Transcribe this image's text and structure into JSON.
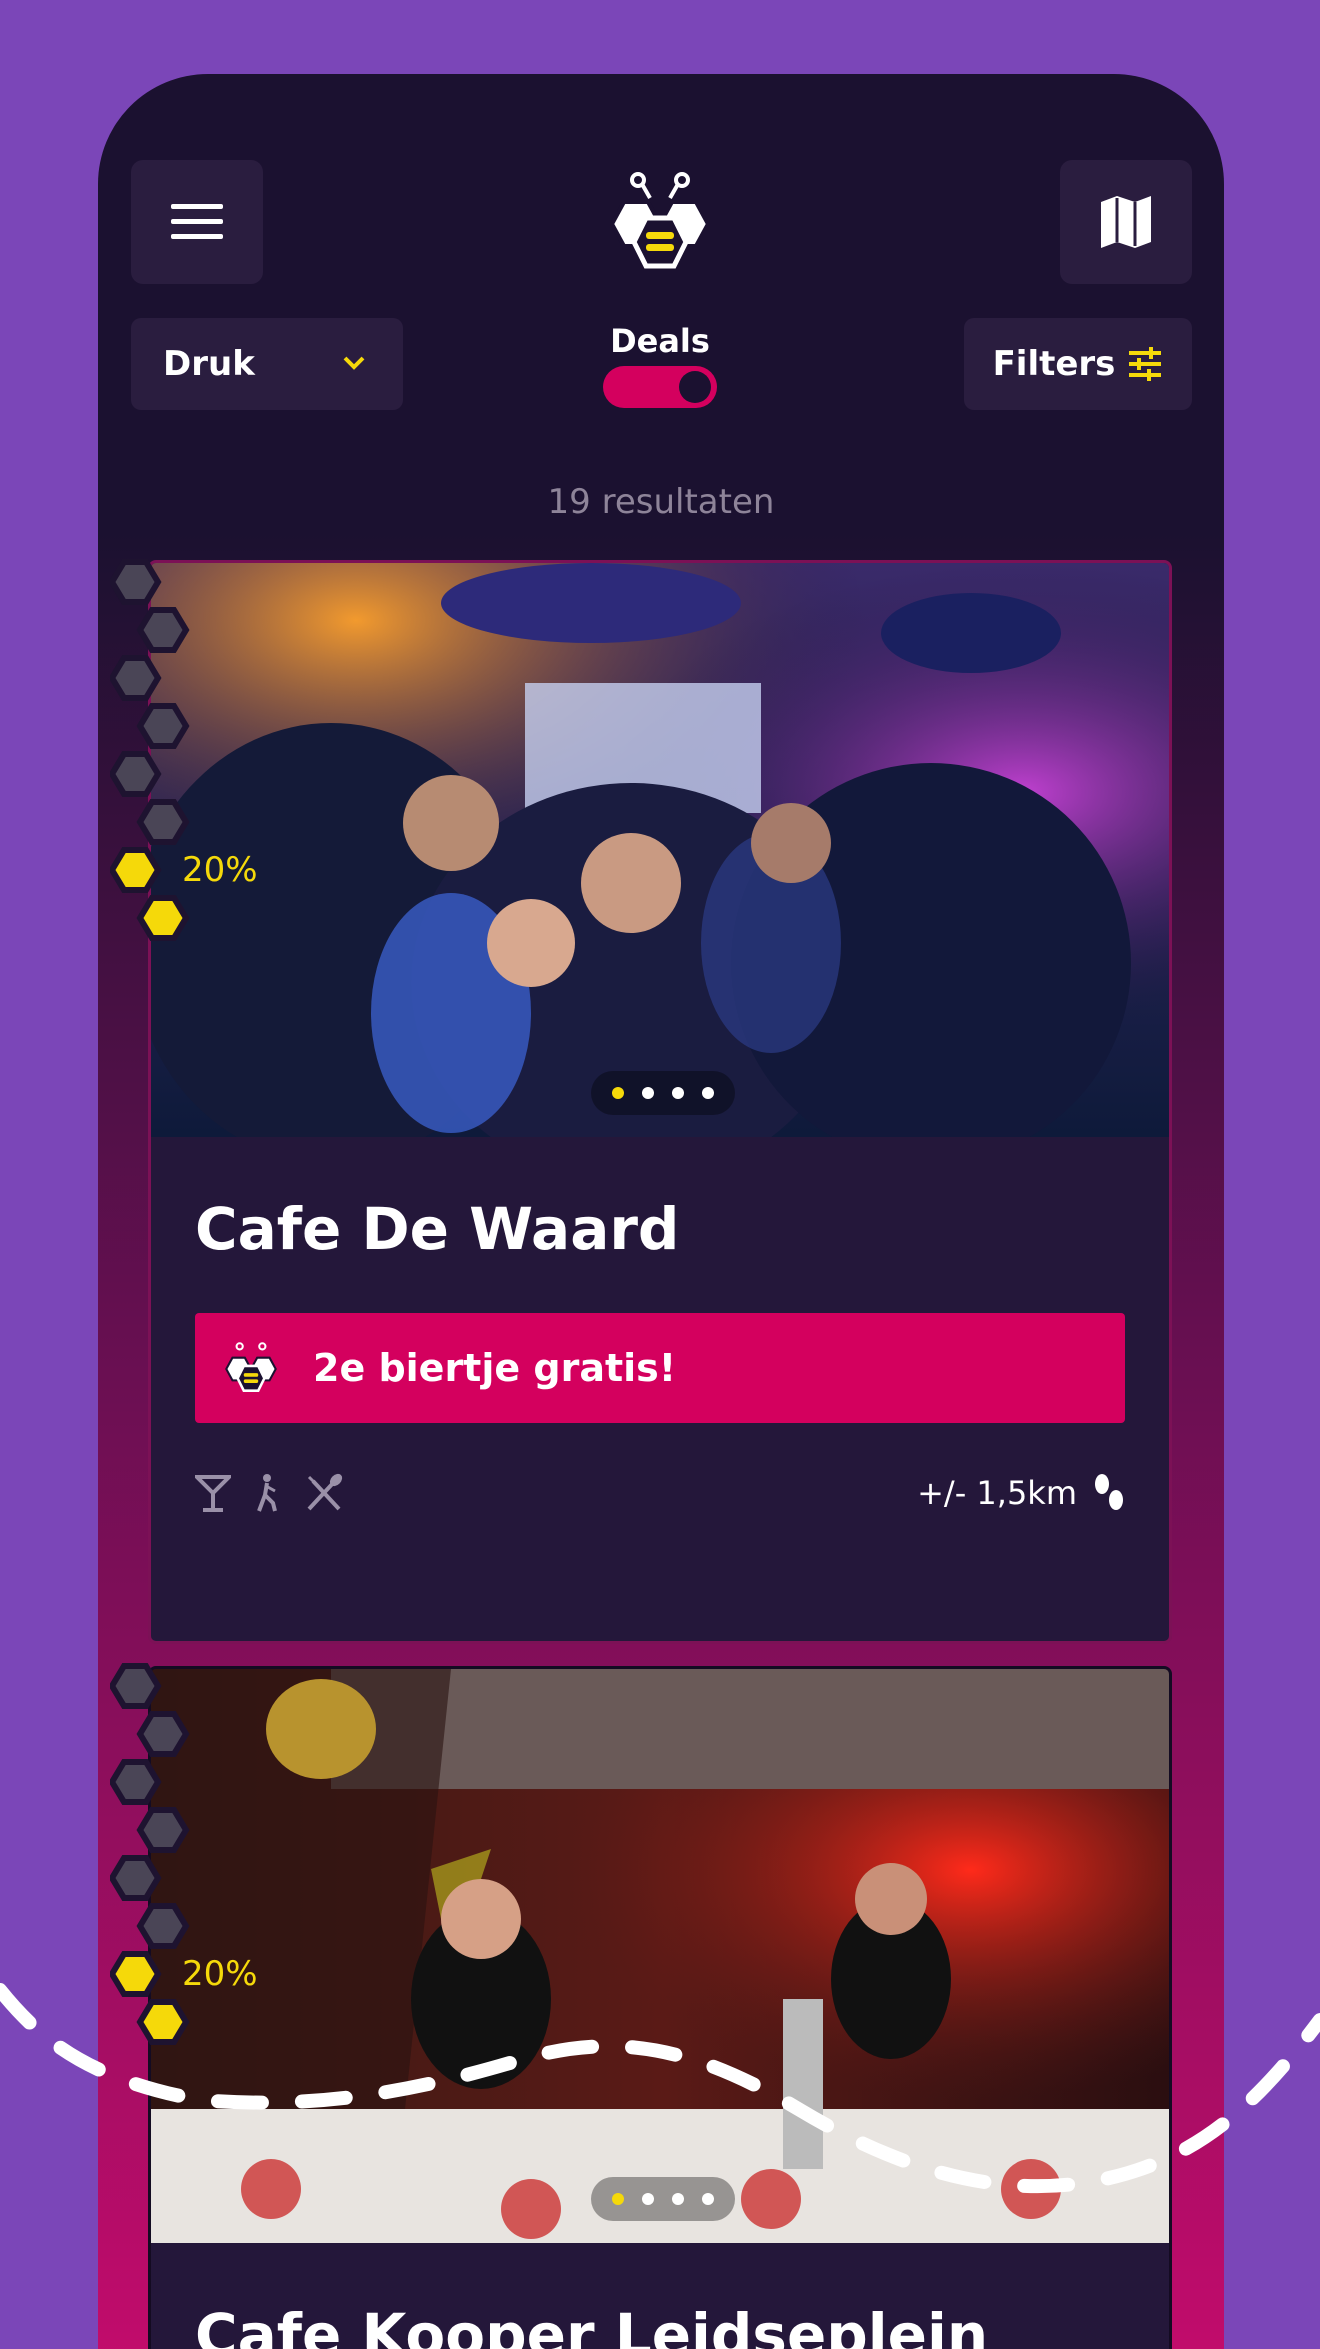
{
  "header": {
    "menu_icon": "hamburger-menu-icon",
    "logo": "bee-logo",
    "map_icon": "map-icon"
  },
  "controls": {
    "sort_value": "Druk",
    "deals_label": "Deals",
    "deals_on": true,
    "filters_label": "Filters"
  },
  "results_text": "19 resultaten",
  "colors": {
    "background": "#7b46b8",
    "panel": "#2a1d3f",
    "accent_pink": "#d4005e",
    "accent_yellow": "#f5d90a"
  },
  "venues": [
    {
      "name": "Cafe De Waard",
      "honey_level_percent": 20,
      "honey_label": "20%",
      "image_index_active": 1,
      "image_count": 4,
      "deal": "2e biertje gratis!",
      "amenities": [
        "cocktail-icon",
        "dance-icon",
        "food-icon"
      ],
      "distance": "+/- 1,5km"
    },
    {
      "name": "Cafe Kooper Leidseplein",
      "honey_level_percent": 20,
      "honey_label": "20%",
      "image_index_active": 1,
      "image_count": 4
    }
  ]
}
